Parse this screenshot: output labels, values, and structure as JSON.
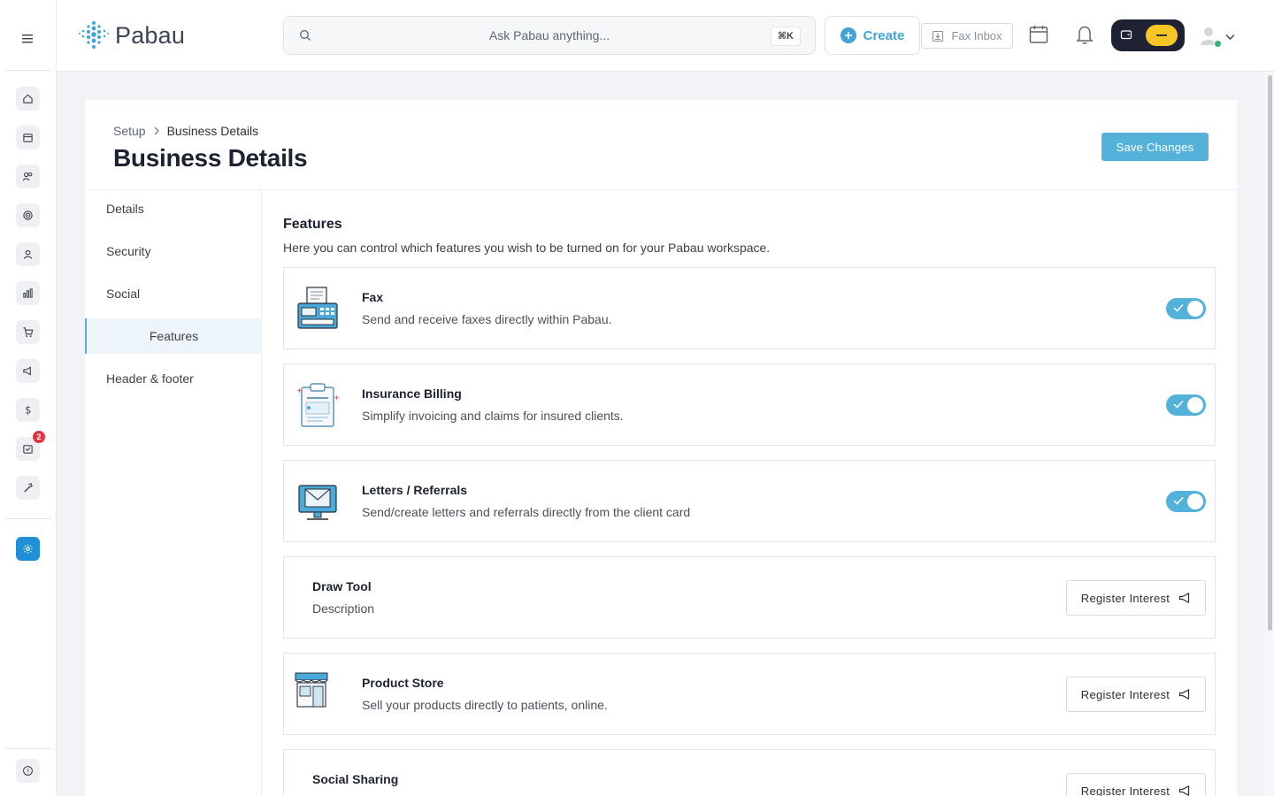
{
  "app": {
    "name": "Pabau"
  },
  "search": {
    "placeholder": "Ask Pabau anything...",
    "shortcut": "⌘K"
  },
  "header": {
    "create_label": "Create",
    "fax_inbox_label": "Fax Inbox"
  },
  "rail": {
    "items": [
      "home-icon",
      "calendar-icon",
      "clients-icon",
      "target-icon",
      "user-icon",
      "chart-icon",
      "cart-icon",
      "megaphone-icon",
      "dollar-icon",
      "inbox-icon",
      "tools-icon",
      "settings-icon",
      "help-icon"
    ],
    "inbox_badge": "2"
  },
  "breadcrumb": {
    "parent": "Setup",
    "current": "Business Details"
  },
  "page": {
    "title": "Business Details",
    "save_label": "Save Changes"
  },
  "subnav": {
    "items": [
      "Details",
      "Security",
      "Social",
      "Features",
      "Header & footer"
    ],
    "active": "Features"
  },
  "features_section": {
    "title": "Features",
    "description": "Here you can control which features you wish to be turned on for your Pabau workspace."
  },
  "features": [
    {
      "name": "Fax",
      "description": "Send and receive faxes directly within Pabau.",
      "icon": "fax-machine-icon",
      "enabled": true
    },
    {
      "name": "Insurance Billing",
      "description": "Simplify invoicing and claims for insured clients.",
      "icon": "clipboard-icon",
      "enabled": true
    },
    {
      "name": "Letters / Referrals",
      "description": "Send/create letters and referrals directly from the client card",
      "icon": "monitor-mail-icon",
      "enabled": true
    },
    {
      "name": "Draw Tool",
      "description": "Description",
      "icon": "",
      "action": "Register Interest"
    },
    {
      "name": "Product Store",
      "description": "Sell your products directly to patients, online.",
      "icon": "storefront-icon",
      "action": "Register Interest"
    },
    {
      "name": "Social Sharing",
      "description": "",
      "icon": "",
      "action": "Register Interest"
    }
  ],
  "colors": {
    "accent": "#54b2da",
    "brand": "#40a4d6",
    "active_rail": "#1f8fd6",
    "badge": "#e0383e"
  }
}
